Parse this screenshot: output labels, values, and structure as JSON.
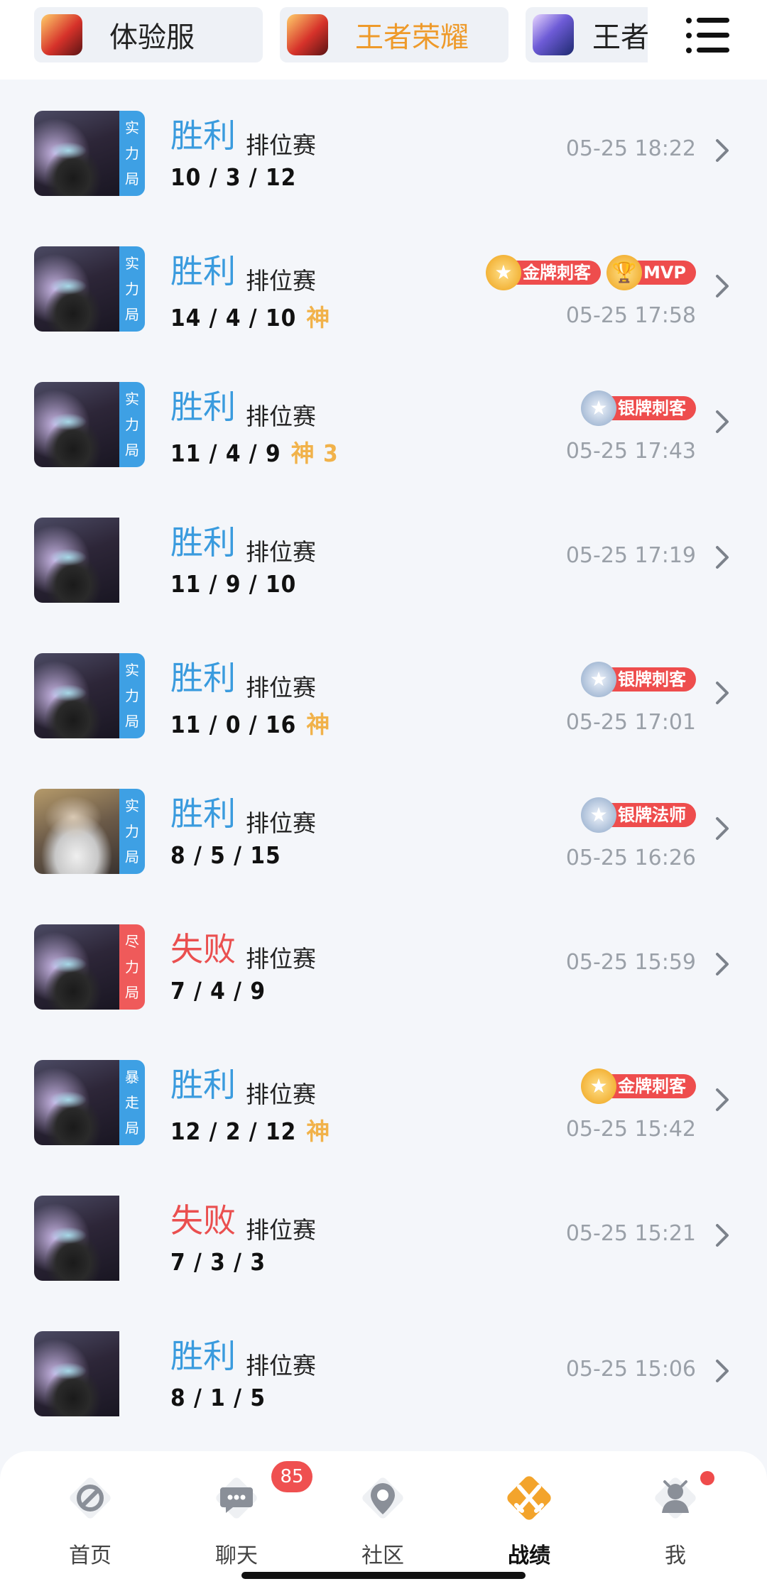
{
  "top_tabs": [
    {
      "label": "体验服",
      "icon": "game-icon",
      "active": false
    },
    {
      "label": "王者荣耀",
      "icon": "game-icon",
      "active": true
    },
    {
      "label": "王者",
      "icon": "game-icon",
      "active": false
    }
  ],
  "menu_icon": "list-menu-icon",
  "matches": [
    {
      "result": "胜利",
      "outcome": "win",
      "mode": "排位赛",
      "kda": "10 / 3 / 12",
      "god": "",
      "tag": [
        "实",
        "力",
        "局"
      ],
      "tag_color": "blue",
      "badges": [],
      "time": "05-25 18:22"
    },
    {
      "result": "胜利",
      "outcome": "win",
      "mode": "排位赛",
      "kda": "14 / 4 / 10",
      "god": "神",
      "tag": [
        "实",
        "力",
        "局"
      ],
      "tag_color": "blue",
      "badges": [
        {
          "label": "金牌刺客",
          "tier": "gold"
        },
        {
          "label": "MVP",
          "tier": "mvp"
        }
      ],
      "time": "05-25 17:58"
    },
    {
      "result": "胜利",
      "outcome": "win",
      "mode": "排位赛",
      "kda": "11 / 4 / 9",
      "god": "神 3",
      "tag": [
        "实",
        "力",
        "局"
      ],
      "tag_color": "blue",
      "badges": [
        {
          "label": "银牌刺客",
          "tier": "silver"
        }
      ],
      "time": "05-25 17:43"
    },
    {
      "result": "胜利",
      "outcome": "win",
      "mode": "排位赛",
      "kda": "11 / 9 / 10",
      "god": "",
      "tag": [],
      "tag_color": "",
      "badges": [],
      "time": "05-25 17:19"
    },
    {
      "result": "胜利",
      "outcome": "win",
      "mode": "排位赛",
      "kda": "11 / 0 / 16",
      "god": "神",
      "tag": [
        "实",
        "力",
        "局"
      ],
      "tag_color": "blue",
      "badges": [
        {
          "label": "银牌刺客",
          "tier": "silver"
        }
      ],
      "time": "05-25 17:01"
    },
    {
      "result": "胜利",
      "outcome": "win",
      "mode": "排位赛",
      "kda": "8 / 5 / 15",
      "god": "",
      "tag": [
        "实",
        "力",
        "局"
      ],
      "tag_color": "blue",
      "badges": [
        {
          "label": "银牌法师",
          "tier": "silver"
        }
      ],
      "time": "05-25 16:26"
    },
    {
      "result": "失败",
      "outcome": "loss",
      "mode": "排位赛",
      "kda": "7 / 4 / 9",
      "god": "",
      "tag": [
        "尽",
        "力",
        "局"
      ],
      "tag_color": "red",
      "badges": [],
      "time": "05-25 15:59"
    },
    {
      "result": "胜利",
      "outcome": "win",
      "mode": "排位赛",
      "kda": "12 / 2 / 12",
      "god": "神",
      "tag": [
        "暴",
        "走",
        "局"
      ],
      "tag_color": "blue",
      "badges": [
        {
          "label": "金牌刺客",
          "tier": "gold"
        }
      ],
      "time": "05-25 15:42"
    },
    {
      "result": "失败",
      "outcome": "loss",
      "mode": "排位赛",
      "kda": "7 / 3 / 3",
      "god": "",
      "tag": [],
      "tag_color": "",
      "badges": [],
      "time": "05-25 15:21"
    },
    {
      "result": "胜利",
      "outcome": "win",
      "mode": "排位赛",
      "kda": "8 / 1 / 5",
      "god": "",
      "tag": [],
      "tag_color": "",
      "badges": [],
      "time": "05-25 15:06"
    }
  ],
  "bottom_nav": [
    {
      "label": "首页",
      "icon": "home-icon",
      "active": false
    },
    {
      "label": "聊天",
      "icon": "chat-icon",
      "active": false,
      "badge": "85"
    },
    {
      "label": "社区",
      "icon": "community-icon",
      "active": false
    },
    {
      "label": "战绩",
      "icon": "swords-icon",
      "active": true
    },
    {
      "label": "我",
      "icon": "profile-icon",
      "active": false,
      "dot": true
    }
  ],
  "colors": {
    "win": "#3a9bde",
    "loss": "#ea4f4f",
    "active_tab": "#ee9a2a",
    "nav_active": "#f3a42c",
    "badge_red": "#ee4d4d"
  }
}
